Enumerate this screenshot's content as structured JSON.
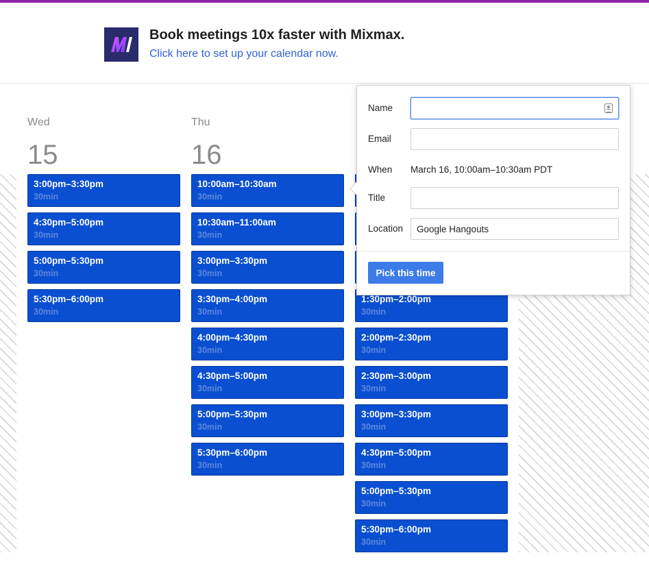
{
  "banner": {
    "title": "Book meetings 10x faster with Mixmax.",
    "link": "Click here to set up your calendar now.",
    "logo_icon": "mixmax-logo-icon",
    "accent_color": "#8e24aa"
  },
  "days": [
    {
      "name": "Wed",
      "date": "15",
      "slots": [
        {
          "time": "3:00pm–3:30pm",
          "duration": "30min"
        },
        {
          "time": "4:30pm–5:00pm",
          "duration": "30min"
        },
        {
          "time": "5:00pm–5:30pm",
          "duration": "30min"
        },
        {
          "time": "5:30pm–6:00pm",
          "duration": "30min"
        }
      ]
    },
    {
      "name": "Thu",
      "date": "16",
      "slots": [
        {
          "time": "10:00am–10:30am",
          "duration": "30min"
        },
        {
          "time": "10:30am–11:00am",
          "duration": "30min"
        },
        {
          "time": "3:00pm–3:30pm",
          "duration": "30min"
        },
        {
          "time": "3:30pm–4:00pm",
          "duration": "30min"
        },
        {
          "time": "4:00pm–4:30pm",
          "duration": "30min"
        },
        {
          "time": "4:30pm–5:00pm",
          "duration": "30min"
        },
        {
          "time": "5:00pm–5:30pm",
          "duration": "30min"
        },
        {
          "time": "5:30pm–6:00pm",
          "duration": "30min"
        }
      ]
    },
    {
      "name": "",
      "date": "",
      "slots": [
        {
          "time": "",
          "duration": ""
        },
        {
          "time": "",
          "duration": ""
        },
        {
          "time": "",
          "duration": ""
        },
        {
          "time": "1:30pm–2:00pm",
          "duration": "30min"
        },
        {
          "time": "2:00pm–2:30pm",
          "duration": "30min"
        },
        {
          "time": "2:30pm–3:00pm",
          "duration": "30min"
        },
        {
          "time": "3:00pm–3:30pm",
          "duration": "30min"
        },
        {
          "time": "4:30pm–5:00pm",
          "duration": "30min"
        },
        {
          "time": "5:00pm–5:30pm",
          "duration": "30min"
        },
        {
          "time": "5:30pm–6:00pm",
          "duration": "30min"
        }
      ]
    }
  ],
  "popover": {
    "name_label": "Name",
    "name_value": "",
    "email_label": "Email",
    "email_value": "",
    "when_label": "When",
    "when_value": "March 16, 10:00am–10:30am PDT",
    "title_label": "Title",
    "title_value": "",
    "location_label": "Location",
    "location_value": "Google Hangouts",
    "button_label": "Pick this time"
  },
  "colors": {
    "slot_bg": "#0a4fd1",
    "slot_duration": "#5d86dd",
    "button_bg": "#3d7be8",
    "link": "#2f5fd7"
  }
}
